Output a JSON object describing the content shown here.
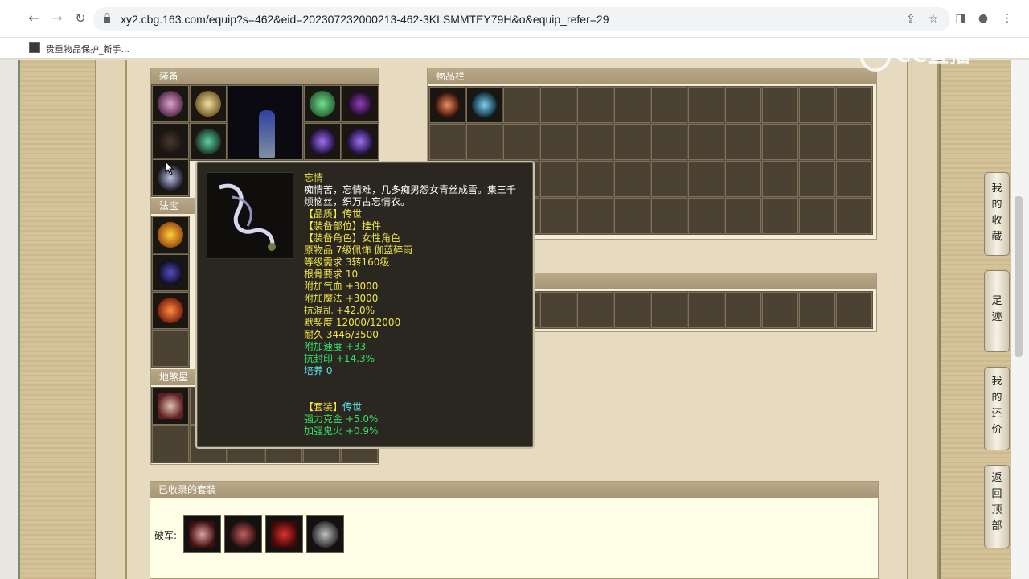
{
  "browser": {
    "url": "xy2.cbg.163.com/equip?s=462&eid=202307232000213-462-3KLSMMTEY79H&o&equip_refer=29",
    "bookmark_label": "贵重物品保护_新手..."
  },
  "panels": {
    "equipment_title": "装备",
    "inventory_title": "物品栏",
    "fabao_title": "法宝",
    "star_title": "地煞星",
    "suits_title": "已收录的套装",
    "suit_row_label": "破军:"
  },
  "tooltip": {
    "name": "忘情",
    "desc1": "痴情苦，忘情难，几多痴男怨女青丝成雪。集三千",
    "desc2": "烦恼丝，织万古忘情衣。",
    "quality": "【品质】传世",
    "slot": "【装备部位】挂件",
    "role": "【装备角色】女性角色",
    "origin": "原物品 7级佩饰 伽蓝碎雨",
    "level": "等级需求 3转160级",
    "bone": "根骨要求 10",
    "hp": "附加气血 +3000",
    "mp": "附加魔法 +3000",
    "resist_chaos": "抗混乱 +42.0%",
    "tacit": "默契度 12000/12000",
    "durability": "耐久 3446/3500",
    "speed": "附加速度 +33",
    "resist_seal": "抗封印 +14.3%",
    "cultivate": "培养 0",
    "suit_label": "【套装】",
    "suit_name": "传世",
    "suit_bonus1": "强力克金 +5.0%",
    "suit_bonus2": "加强鬼火 +0.9%"
  },
  "side_buttons": [
    {
      "label": [
        "我",
        "的",
        "收",
        "藏"
      ]
    },
    {
      "label": [
        "足",
        "迹"
      ]
    },
    {
      "label": [
        "我",
        "的",
        "还",
        "价"
      ]
    },
    {
      "label": [
        "返",
        "回",
        "顶",
        "部"
      ]
    }
  ],
  "watermark": "CC直播",
  "colors": {
    "tooltip_bg": "#2a2620",
    "name_yellow": "#f2e64a",
    "bonus_green": "#35e066",
    "cultivate_cyan": "#58e0e8",
    "panel_header": "#a69676"
  }
}
